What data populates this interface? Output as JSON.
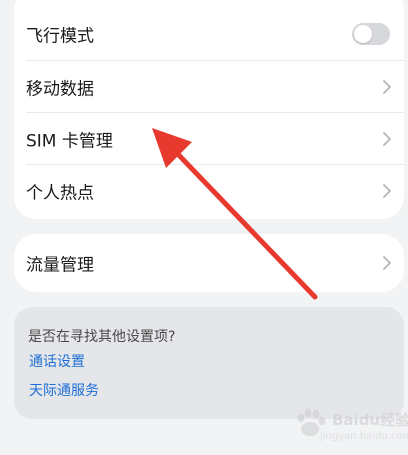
{
  "network_settings": {
    "items": [
      {
        "label": "飞行模式",
        "control": "toggle",
        "on": false
      },
      {
        "label": "移动数据",
        "control": "chevron-right-icon"
      },
      {
        "label": "SIM 卡管理",
        "control": "chevron-right-icon"
      },
      {
        "label": "个人热点",
        "control": "chevron-right-icon"
      }
    ]
  },
  "traffic": {
    "label": "流量管理",
    "control": "chevron-right-icon"
  },
  "help": {
    "title": "是否在寻找其他设置项?",
    "links": [
      "通话设置",
      "天际通服务"
    ]
  },
  "annotation": {
    "type": "red-arrow",
    "color": "#e8392f",
    "points_to": "SIM 卡管理"
  },
  "watermark": {
    "brand": "Baidu经验",
    "url": "jingyan.baidu.com"
  },
  "colors": {
    "background": "#f1f3f5",
    "card": "#ffffff",
    "link": "#1f6fd6",
    "help_card": "#e4e6e9"
  }
}
